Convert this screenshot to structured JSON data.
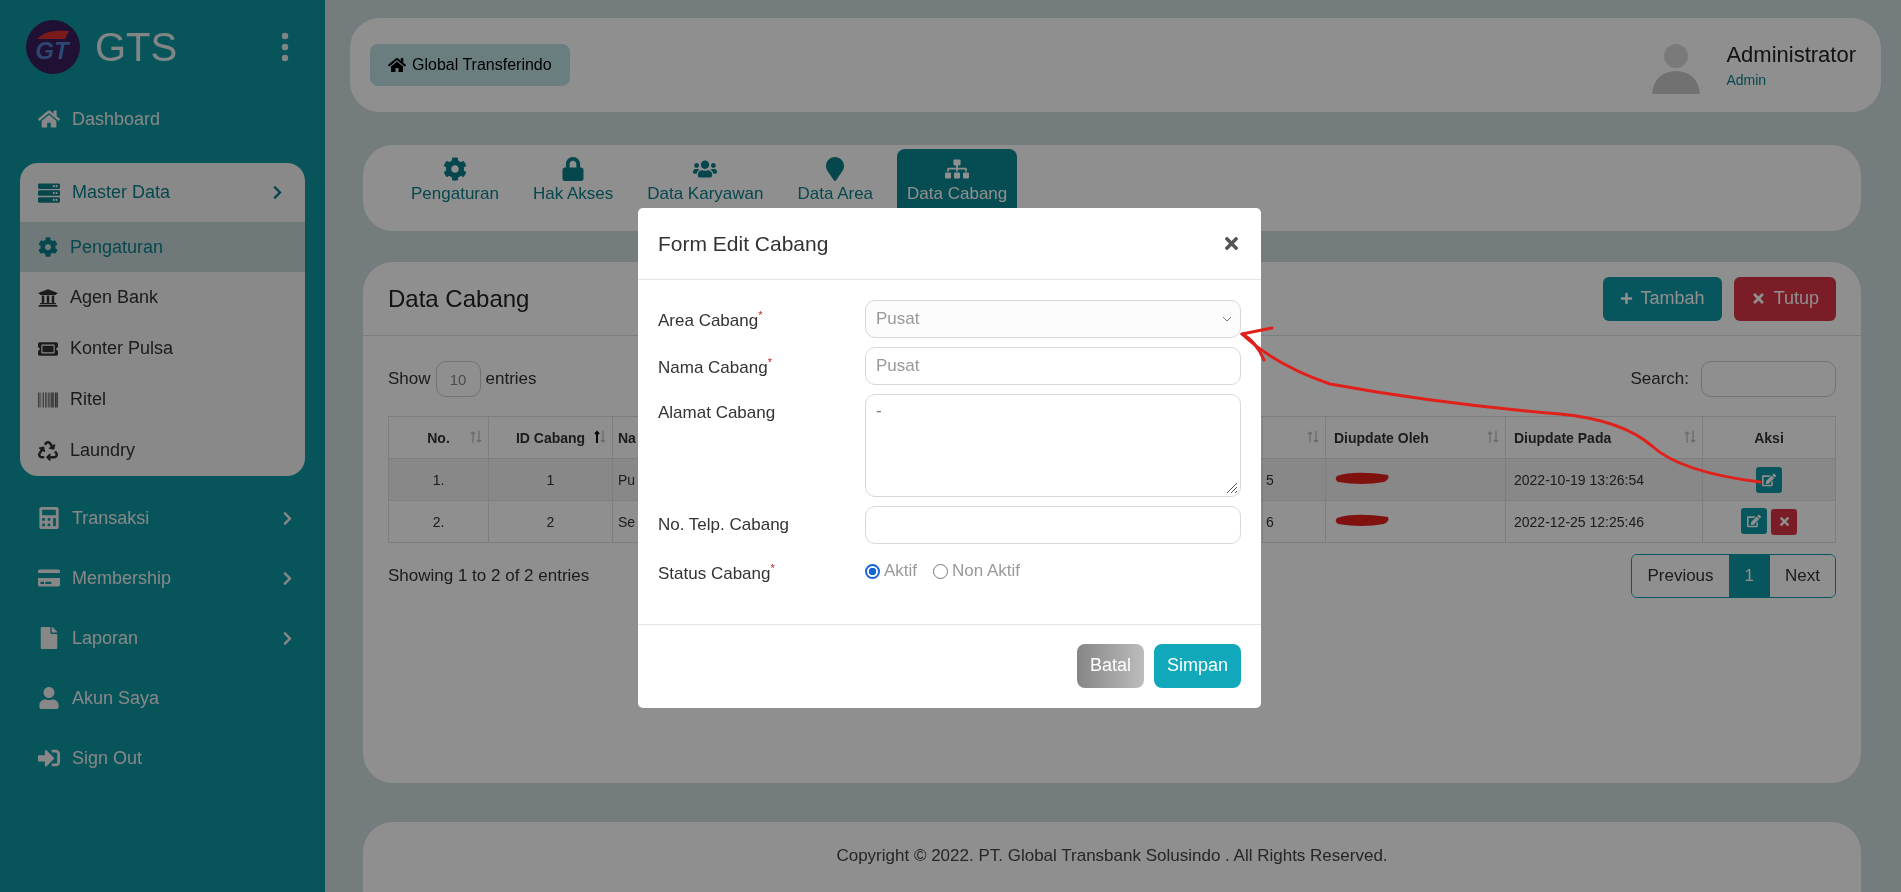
{
  "brand": {
    "logo_text": "GT",
    "name": "GTS"
  },
  "sidebar": {
    "items": [
      {
        "label": "Dashboard",
        "expandable": false,
        "selected": false
      },
      {
        "label": "Master Data",
        "expandable": true,
        "selected": false,
        "children": [
          {
            "label": "Pengaturan",
            "selected": true
          },
          {
            "label": "Agen Bank",
            "selected": false
          },
          {
            "label": "Konter Pulsa",
            "selected": false
          },
          {
            "label": "Ritel",
            "selected": false
          },
          {
            "label": "Laundry",
            "selected": false
          }
        ]
      },
      {
        "label": "Transaksi",
        "expandable": true,
        "selected": false
      },
      {
        "label": "Membership",
        "expandable": true,
        "selected": false
      },
      {
        "label": "Laporan",
        "expandable": true,
        "selected": false
      },
      {
        "label": "Akun Saya",
        "expandable": false,
        "selected": false
      },
      {
        "label": "Sign Out",
        "expandable": false,
        "selected": false
      }
    ]
  },
  "header": {
    "breadcrumb": "Global Transferindo",
    "user": {
      "name": "Administrator",
      "role": "Admin"
    }
  },
  "tabs": [
    {
      "label": "Pengaturan",
      "selected": false
    },
    {
      "label": "Hak Akses",
      "selected": false
    },
    {
      "label": "Data Karyawan",
      "selected": false
    },
    {
      "label": "Data Area",
      "selected": false
    },
    {
      "label": "Data Cabang",
      "selected": true
    }
  ],
  "panel": {
    "title": "Data Cabang",
    "buttons": [
      {
        "label": "Tambah",
        "kind": "add"
      },
      {
        "label": "Tutup",
        "kind": "close"
      }
    ],
    "length": {
      "prefix": "Show",
      "value": "10",
      "suffix": "entries"
    },
    "search_label": "Search:",
    "table": {
      "columns": [
        {
          "label": "No.",
          "sortable": true,
          "sorted": false
        },
        {
          "label": "ID Cabang",
          "sortable": true,
          "sorted": true
        },
        {
          "label": "Na",
          "sortable": false
        },
        {
          "sortable": true,
          "sorted": false
        },
        {
          "label": "Diupdate Oleh",
          "sortable": true,
          "sorted": false
        },
        {
          "label": "Diupdate Pada",
          "sortable": true,
          "sorted": false
        },
        {
          "label": "Aksi",
          "sortable": false
        }
      ],
      "rows": [
        {
          "no": "1.",
          "id": "1",
          "column_3": "Pu",
          "column_4": "5",
          "updated_by_redacted": true,
          "updated_at": "2022-10-19 13:26:54",
          "actions": [
            {
              "kind": "edit"
            }
          ]
        },
        {
          "no": "2.",
          "id": "2",
          "column_3": "Se",
          "column_4": "6",
          "updated_by_redacted": true,
          "updated_at": "2022-12-25 12:25:46",
          "actions": [
            {
              "kind": "edit"
            },
            {
              "kind": "delete"
            }
          ]
        }
      ]
    },
    "info": "Showing 1 to 2 of 2 entries",
    "pagination": [
      {
        "label": "Previous",
        "selected": false
      },
      {
        "label": "1",
        "selected": true
      },
      {
        "label": "Next",
        "selected": false
      }
    ]
  },
  "footer": "Copyright © 2022. PT. Global Transbank Solusindo . All Rights Reserved.",
  "modal": {
    "title": "Form Edit Cabang",
    "fields": [
      {
        "label": "Area Cabang$^{*}$",
        "kind": "select",
        "value": "Pusat"
      },
      {
        "label": "Nama Cabang$^{*}$",
        "kind": "text",
        "value": "Pusat"
      },
      {
        "label": "Alamat Cabang",
        "kind": "textarea",
        "value": "-"
      },
      {
        "label": "No. Telp. Cabang",
        "kind": "text"
      },
      {
        "label": "Status Cabang$^{*}$",
        "kind": "radio",
        "options": [
          {
            "label": "Aktif",
            "selected": true
          },
          {
            "label": "Non Aktif",
            "selected": false
          }
        ]
      }
    ],
    "buttons": [
      {
        "label": "Batal",
        "kind": "cancel"
      },
      {
        "label": "Simpan",
        "kind": "submit"
      }
    ]
  },
  "annotation": {
    "kind": "arrow"
  }
}
